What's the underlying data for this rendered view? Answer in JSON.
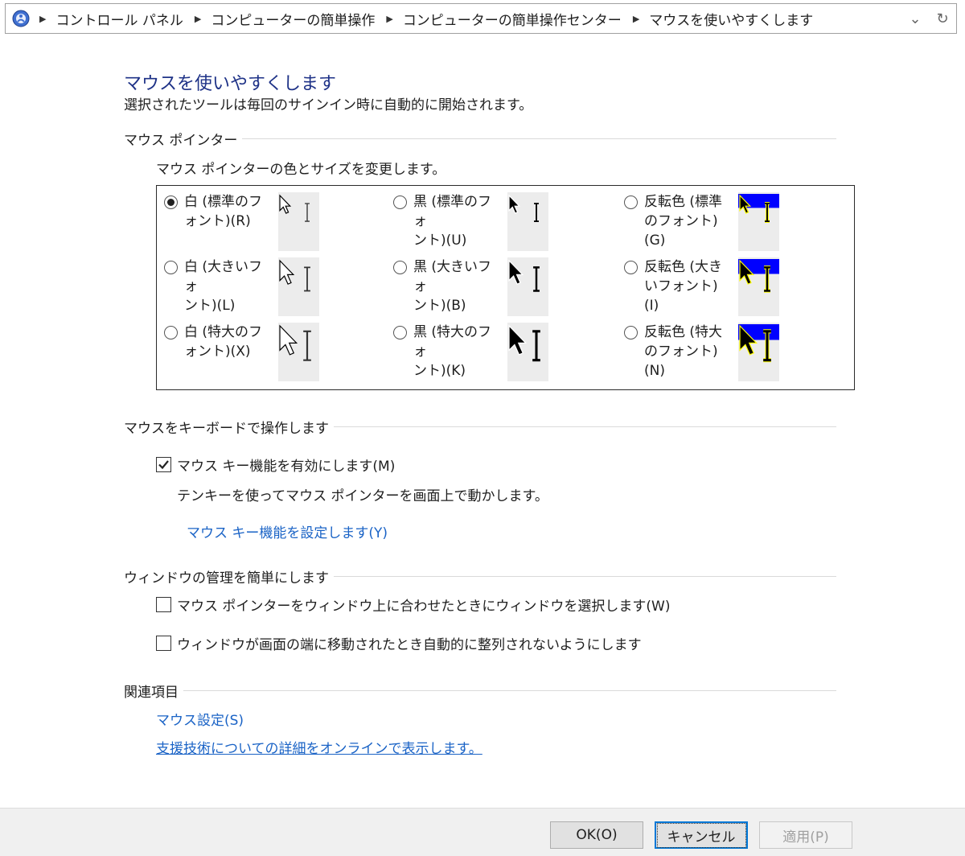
{
  "breadcrumbs": [
    "コントロール パネル",
    "コンピューターの簡単操作",
    "コンピューターの簡単操作センター",
    "マウスを使いやすくします"
  ],
  "header": {
    "title": "マウスを使いやすくします",
    "subtitle": "選択されたツールは毎回のサインイン時に自動的に開始されます。"
  },
  "pointer_section": {
    "heading": "マウス ポインター",
    "description": "マウス ポインターの色とサイズを変更します。",
    "options": [
      {
        "line1": "白 (標準のフ",
        "line2": "ォント)(R)",
        "checked": true,
        "scheme": "white",
        "size": "small"
      },
      {
        "line1": "黒 (標準のフォ",
        "line2": "ント)(U)",
        "checked": false,
        "scheme": "black",
        "size": "small"
      },
      {
        "line1": "反転色 (標準",
        "line2": "のフォント)(G)",
        "checked": false,
        "scheme": "inverted",
        "size": "small"
      },
      {
        "line1": "白 (大きいフォ",
        "line2": "ント)(L)",
        "checked": false,
        "scheme": "white",
        "size": "medium"
      },
      {
        "line1": "黒 (大きいフォ",
        "line2": "ント)(B)",
        "checked": false,
        "scheme": "black",
        "size": "medium"
      },
      {
        "line1": "反転色 (大き",
        "line2": "いフォント)(I)",
        "checked": false,
        "scheme": "inverted",
        "size": "medium"
      },
      {
        "line1": "白 (特大のフ",
        "line2": "ォント)(X)",
        "checked": false,
        "scheme": "white",
        "size": "large"
      },
      {
        "line1": "黒 (特大のフォ",
        "line2": "ント)(K)",
        "checked": false,
        "scheme": "black",
        "size": "large"
      },
      {
        "line1": "反転色 (特大",
        "line2": "のフォント)(N)",
        "checked": false,
        "scheme": "inverted",
        "size": "large"
      }
    ]
  },
  "keyboard_section": {
    "heading": "マウスをキーボードで操作します",
    "mouse_keys_label": "マウス キー機能を有効にします(M)",
    "mouse_keys_checked": true,
    "mouse_keys_description": "テンキーを使ってマウス ポインターを画面上で動かします。",
    "setup_link": "マウス キー機能を設定します(Y)"
  },
  "window_section": {
    "heading": "ウィンドウの管理を簡単にします",
    "hover_select_label": "マウス ポインターをウィンドウ上に合わせたときにウィンドウを選択します(W)",
    "hover_select_checked": false,
    "no_snap_label": "ウィンドウが画面の端に移動されたとき自動的に整列されないようにします",
    "no_snap_checked": false
  },
  "related_section": {
    "heading": "関連項目",
    "mouse_settings_link": "マウス設定(S)",
    "online_link": "支援技術についての詳細をオンラインで表示します。"
  },
  "buttons": {
    "ok": "OK(O)",
    "cancel": "キャンセル",
    "apply": "適用(P)"
  },
  "colors": {
    "title": "#1e3287",
    "link": "#1a63c6",
    "inverted_blue": "#0000ff",
    "inverted_yellow": "#ffff00"
  }
}
